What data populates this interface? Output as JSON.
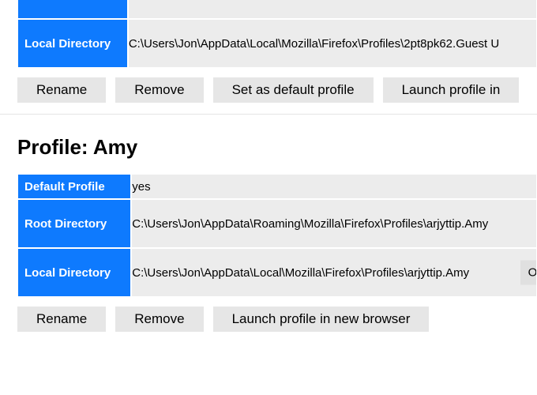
{
  "labels": {
    "default_profile": "Default Profile",
    "root_directory": "Root Directory",
    "local_directory": "Local Directory"
  },
  "buttons": {
    "rename": "Rename",
    "remove": "Remove",
    "set_default": "Set as default profile",
    "launch_profile_cut": "Launch profile in",
    "launch_profile": "Launch profile in new browser",
    "open_folder_cut": "Ope"
  },
  "profile1": {
    "local_dir": "C:\\Users\\Jon\\AppData\\Local\\Mozilla\\Firefox\\Profiles\\2pt8pk62.Guest U"
  },
  "profile2": {
    "title": "Profile: Amy",
    "default_profile": "yes",
    "root_dir": "C:\\Users\\Jon\\AppData\\Roaming\\Mozilla\\Firefox\\Profiles\\arjyttip.Amy",
    "local_dir": "C:\\Users\\Jon\\AppData\\Local\\Mozilla\\Firefox\\Profiles\\arjyttip.Amy"
  }
}
